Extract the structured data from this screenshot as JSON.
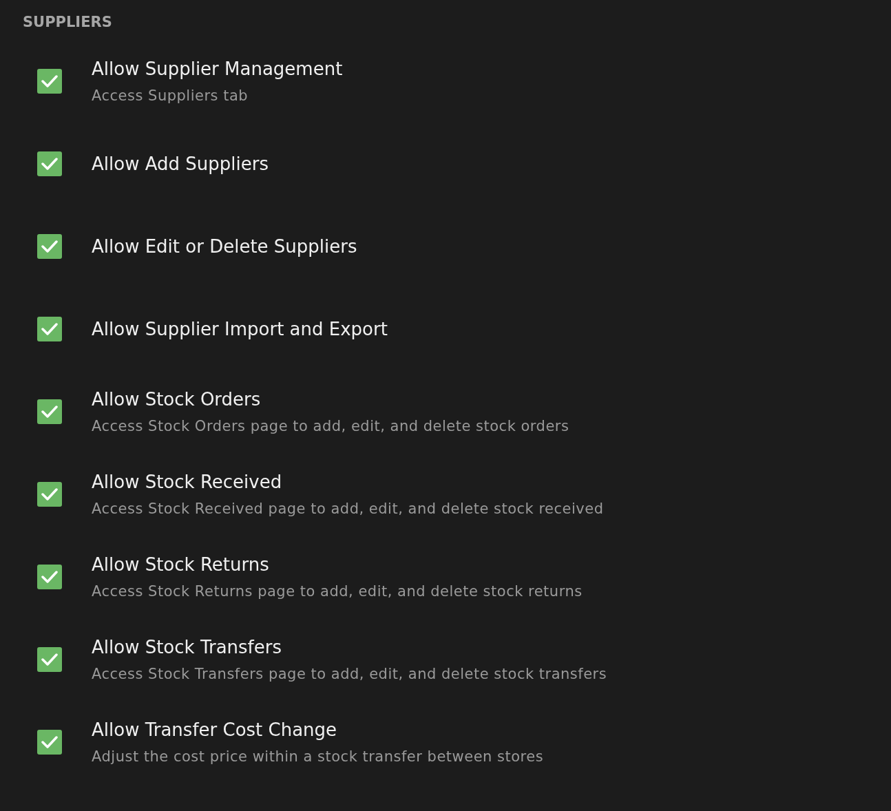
{
  "section": {
    "title": "SUPPLIERS"
  },
  "permissions": [
    {
      "title": "Allow Supplier Management",
      "description": "Access Suppliers tab",
      "checked": true
    },
    {
      "title": "Allow Add Suppliers",
      "checked": true
    },
    {
      "title": "Allow Edit or Delete Suppliers",
      "checked": true
    },
    {
      "title": "Allow Supplier Import and Export",
      "checked": true
    },
    {
      "title": "Allow Stock Orders",
      "description": "Access Stock Orders page to add, edit, and delete stock orders",
      "checked": true
    },
    {
      "title": "Allow Stock Received",
      "description": "Access Stock Received page to add, edit, and delete stock received",
      "checked": true
    },
    {
      "title": "Allow Stock Returns",
      "description": "Access Stock Returns page to add, edit, and delete stock returns",
      "checked": true
    },
    {
      "title": "Allow Stock Transfers",
      "description": "Access Stock Transfers page to add, edit, and delete stock transfers",
      "checked": true
    },
    {
      "title": "Allow Transfer Cost Change",
      "description": "Adjust the cost price within a stock transfer between stores",
      "checked": true
    }
  ]
}
